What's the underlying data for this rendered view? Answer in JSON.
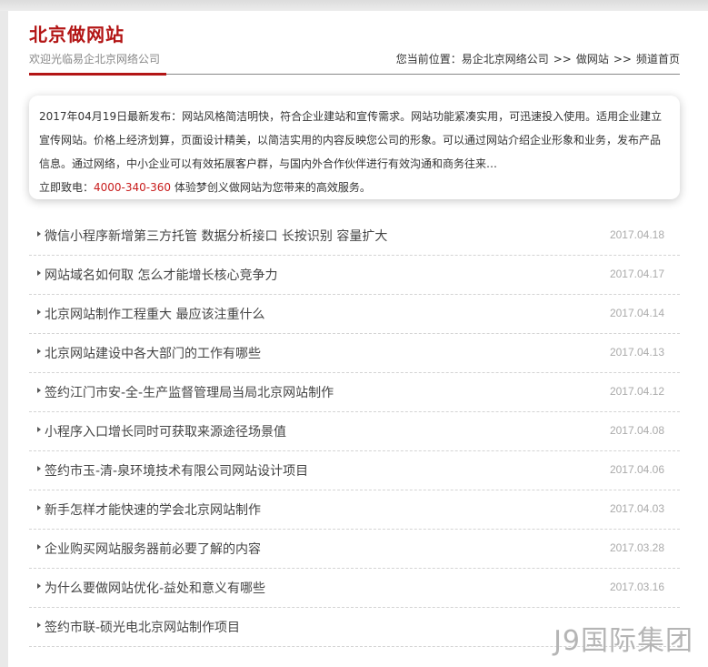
{
  "header": {
    "title": "北京做网站",
    "subtitle": "欢迎光临易企北京网络公司"
  },
  "breadcrumb": {
    "prefix": "您当前位置：",
    "items": [
      "易企北京网络公司",
      "做网站",
      "频道首页"
    ],
    "separator": ">>"
  },
  "intro": {
    "text": "2017年04月19日最新发布：网站风格简洁明快，符合企业建站和宣传需求。网站功能紧凑实用，可迅速投入使用。适用企业建立宣传网站。价格上经济划算，页面设计精美，以简洁实用的内容反映您公司的形象。可以通过网站介绍企业形象和业务，发布产品信息。通过网络，中小企业可以有效拓展客户群，与国内外合作伙伴进行有效沟通和商务往来…",
    "call_prefix": "立即致电：",
    "phone": "4000-340-360",
    "call_suffix": "体验梦创义做网站为您带来的高效服务。"
  },
  "news": [
    {
      "title": "微信小程序新增第三方托管 数据分析接口 长按识别 容量扩大",
      "date": "2017.04.18"
    },
    {
      "title": "网站域名如何取 怎么才能增长核心竞争力",
      "date": "2017.04.17"
    },
    {
      "title": "北京网站制作工程重大 最应该注重什么",
      "date": "2017.04.14"
    },
    {
      "title": "北京网站建设中各大部门的工作有哪些",
      "date": "2017.04.13"
    },
    {
      "title": "签约江门市安-全-生产监督管理局当局北京网站制作",
      "date": "2017.04.12"
    },
    {
      "title": "小程序入口增长同时可获取来源途径场景值",
      "date": "2017.04.08"
    },
    {
      "title": "签约市玉-清-泉环境技术有限公司网站设计项目",
      "date": "2017.04.06"
    },
    {
      "title": "新手怎样才能快速的学会北京网站制作",
      "date": "2017.04.03"
    },
    {
      "title": "企业购买网站服务器前必要了解的内容",
      "date": "2017.03.28"
    },
    {
      "title": "为什么要做网站优化-益处和意义有哪些",
      "date": "2017.03.16"
    },
    {
      "title": "签约市联-硕光电北京网站制作项目",
      "date": ""
    }
  ],
  "watermark": "J9国际集团",
  "colors": {
    "accent": "#b31515",
    "phone": "#c81d1d",
    "date": "#aaaaaa"
  }
}
